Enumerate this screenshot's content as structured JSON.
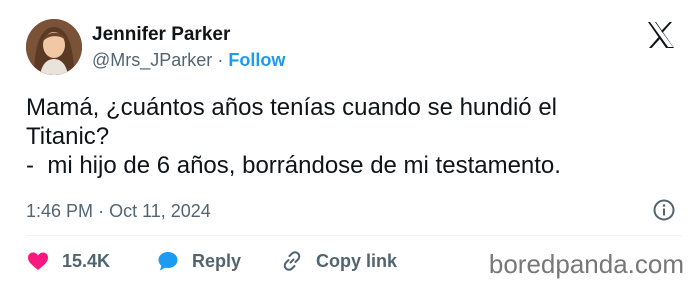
{
  "tweet": {
    "author_name": "Jennifer Parker",
    "handle": "@Mrs_JParker",
    "separator": "·",
    "follow_label": "Follow",
    "text": "Mamá, ¿cuántos años tenías cuando se hundió el\nTitanic?\n-  mi hijo de 6 años, borrándose de mi testamento.",
    "time": "1:46 PM",
    "date": "Oct 11, 2024"
  },
  "actions": {
    "likes_count": "15.4K",
    "reply_label": "Reply",
    "copy_link_label": "Copy link"
  },
  "icons": {
    "platform": "x-logo-icon",
    "info": "info-icon",
    "like": "heart-icon",
    "reply": "speech-bubble-icon",
    "copy": "link-icon"
  },
  "colors": {
    "text": "#0f1419",
    "secondary": "#536471",
    "follow": "#1d9bf0",
    "like": "#f91880",
    "reply": "#1d9bf0",
    "watermark": "#777777"
  },
  "watermark": "boredpanda.com"
}
